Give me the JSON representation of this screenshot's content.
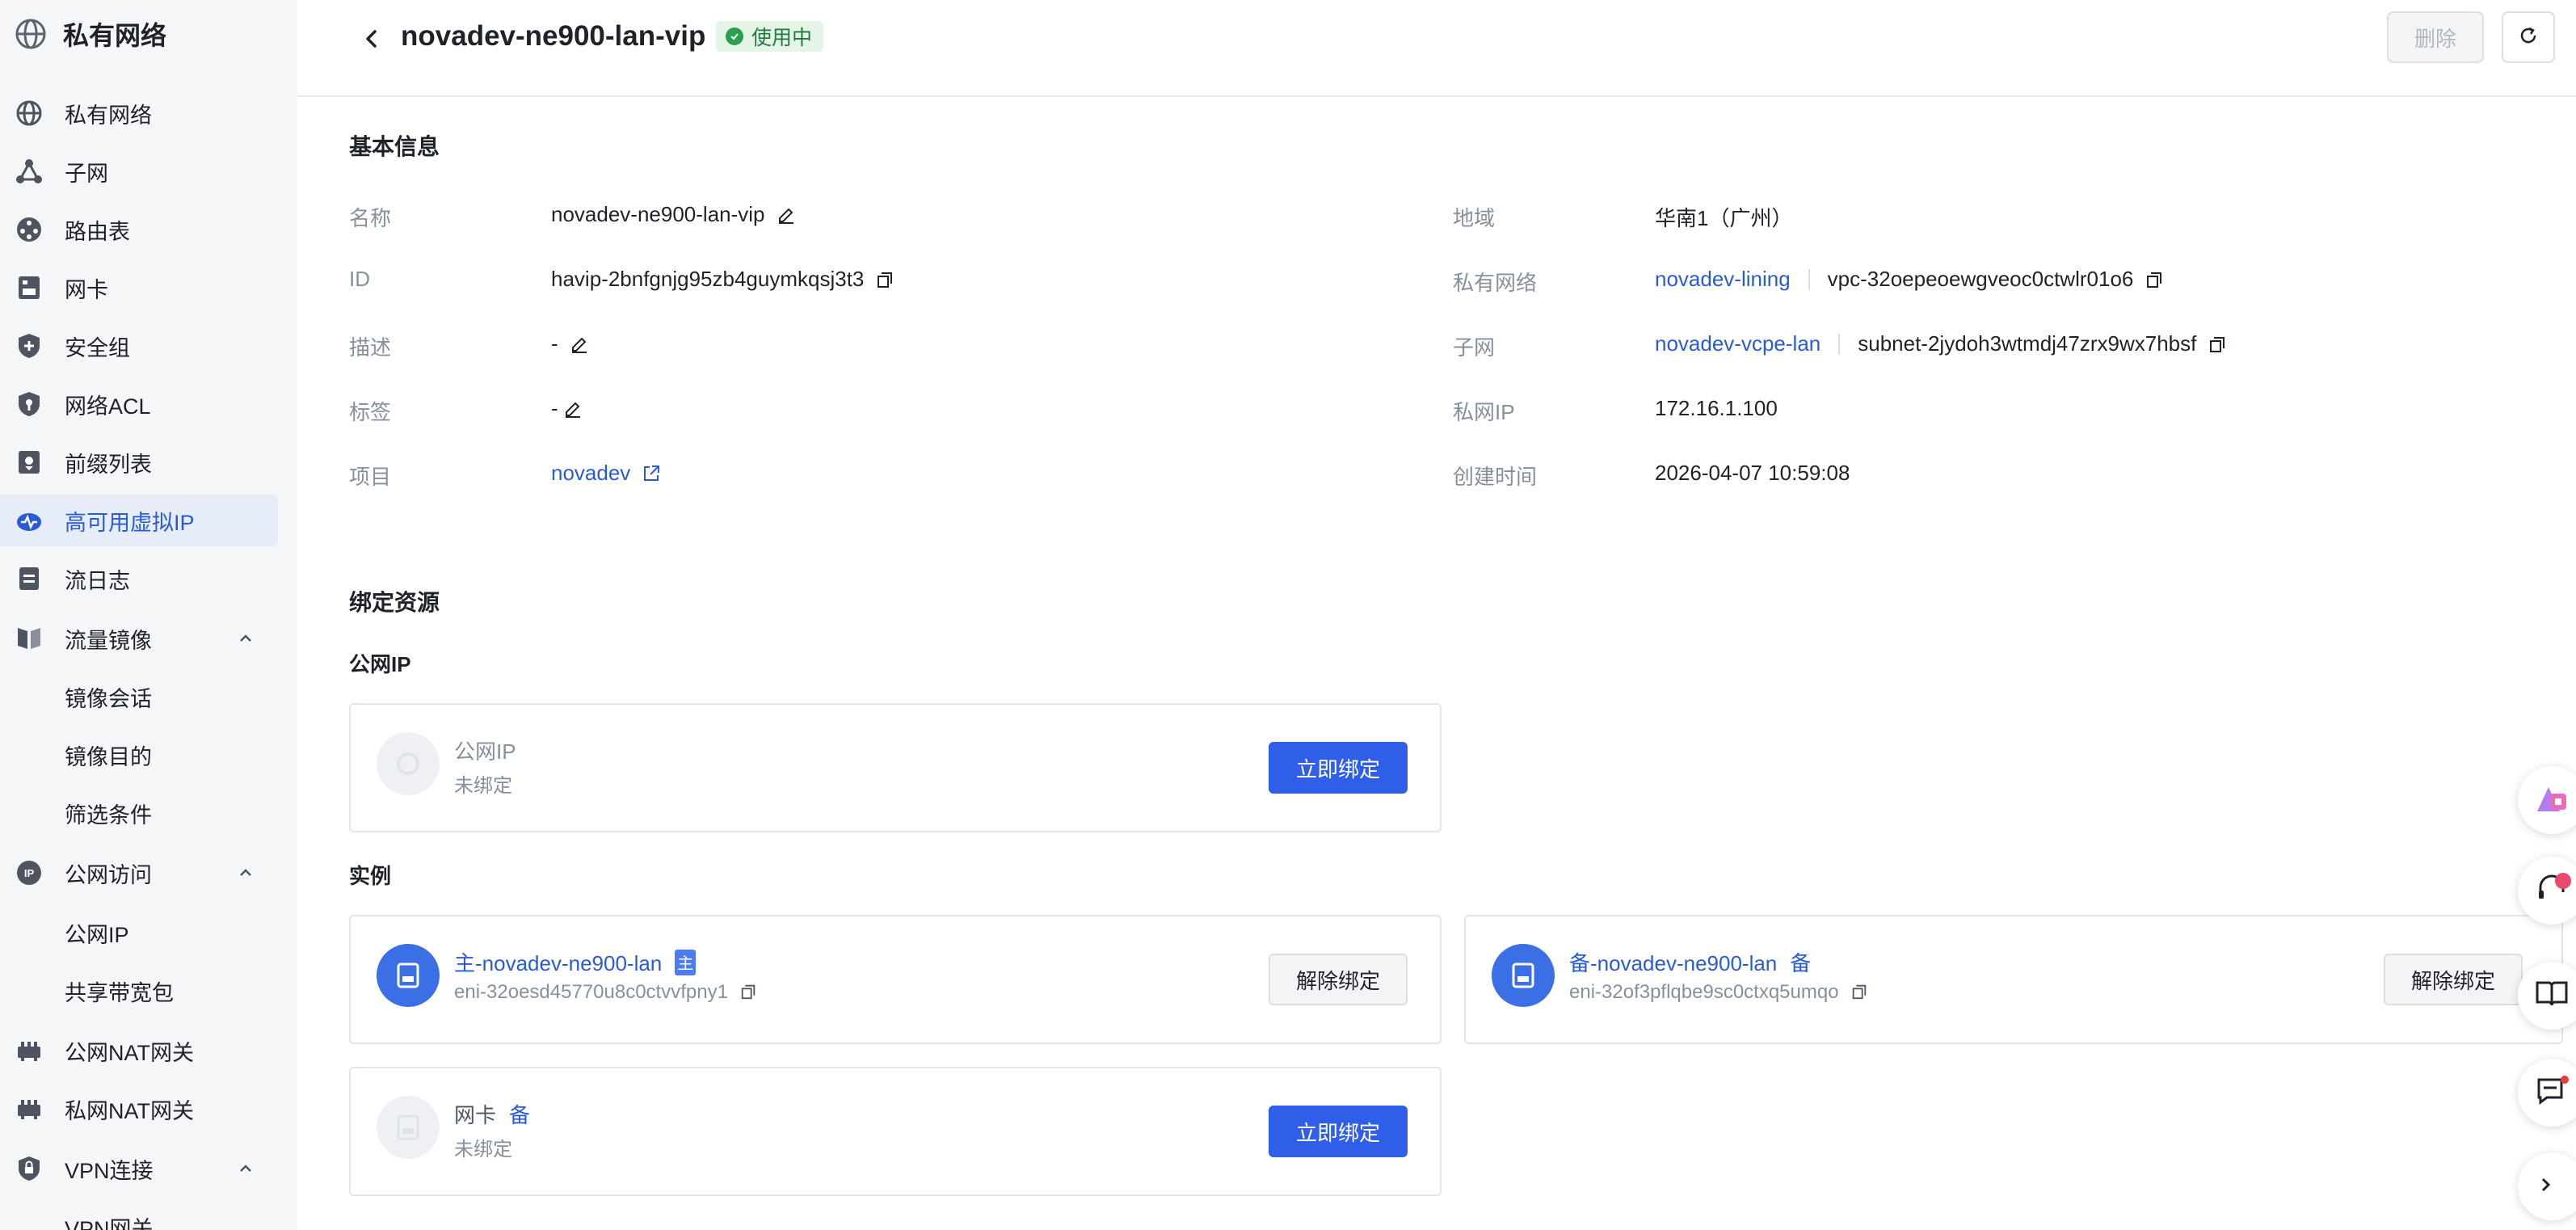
{
  "sidebar": {
    "title": "私有网络",
    "items": [
      {
        "label": "私有网络",
        "icon": "globe-icon"
      },
      {
        "label": "子网",
        "icon": "subnet-icon"
      },
      {
        "label": "路由表",
        "icon": "route-icon"
      },
      {
        "label": "网卡",
        "icon": "nic-icon"
      },
      {
        "label": "安全组",
        "icon": "shield-icon"
      },
      {
        "label": "网络ACL",
        "icon": "acl-shield-icon"
      },
      {
        "label": "前缀列表",
        "icon": "prefix-icon"
      },
      {
        "label": "高可用虚拟IP",
        "icon": "havip-cloud-icon",
        "active": true
      },
      {
        "label": "流日志",
        "icon": "log-icon"
      },
      {
        "label": "流量镜像",
        "icon": "mirror-icon",
        "expanded": true
      },
      {
        "label": "镜像会话"
      },
      {
        "label": "镜像目的"
      },
      {
        "label": "筛选条件"
      },
      {
        "label": "公网访问",
        "icon": "ip-icon",
        "expanded": true
      },
      {
        "label": "公网IP"
      },
      {
        "label": "共享带宽包"
      },
      {
        "label": "公网NAT网关",
        "icon": "nat-icon"
      },
      {
        "label": "私网NAT网关",
        "icon": "nat-icon"
      },
      {
        "label": "VPN连接",
        "icon": "vpn-icon",
        "expanded": true
      },
      {
        "label": "VPN网关"
      }
    ]
  },
  "header": {
    "title": "novadev-ne900-lan-vip",
    "status": "使用中",
    "delete_label": "删除"
  },
  "basic": {
    "section_title": "基本信息",
    "left": [
      {
        "label": "名称",
        "value": "novadev-ne900-lan-vip"
      },
      {
        "label": "ID",
        "value": "havip-2bnfgnjg95zb4guymkqsj3t3"
      },
      {
        "label": "描述",
        "value": "-"
      },
      {
        "label": "标签",
        "value": "-"
      },
      {
        "label": "项目",
        "value": "novadev"
      }
    ],
    "right": [
      {
        "label": "地域",
        "value": "华南1（广州）"
      },
      {
        "label": "私有网络",
        "link": "novadev-lining",
        "value": "vpc-32oepeoewgveoc0ctwlr01o6"
      },
      {
        "label": "子网",
        "link": "novadev-vcpe-lan",
        "value": "subnet-2jydoh3wtmdj47zrx9wx7hbsf"
      },
      {
        "label": "私网IP",
        "value": "172.16.1.100"
      },
      {
        "label": "创建时间",
        "value": "2026-04-07 10:59:08"
      }
    ]
  },
  "bind": {
    "section_title": "绑定资源",
    "public_ip_title": "公网IP",
    "public_ip_card": {
      "title": "公网IP",
      "sub": "未绑定",
      "button": "立即绑定"
    },
    "instance_title": "实例",
    "instance_main": {
      "title": "主-novadev-ne900-lan",
      "tag": "主",
      "sub": "eni-32oesd45770u8c0ctvvfpny1",
      "button": "解除绑定"
    },
    "instance_backup": {
      "title": "备-novadev-ne900-lan",
      "tag": "备",
      "sub": "eni-32of3pflqbe9sc0ctxq5umqo",
      "button": "解除绑定"
    },
    "nic_card": {
      "title": "网卡",
      "tag": "备",
      "sub": "未绑定",
      "button": "立即绑定"
    }
  },
  "colors": {
    "primary": "#2f5fe8",
    "link": "#2a5bd7",
    "status_bg": "#e4f5e8",
    "status_text": "#1f7a3b"
  }
}
